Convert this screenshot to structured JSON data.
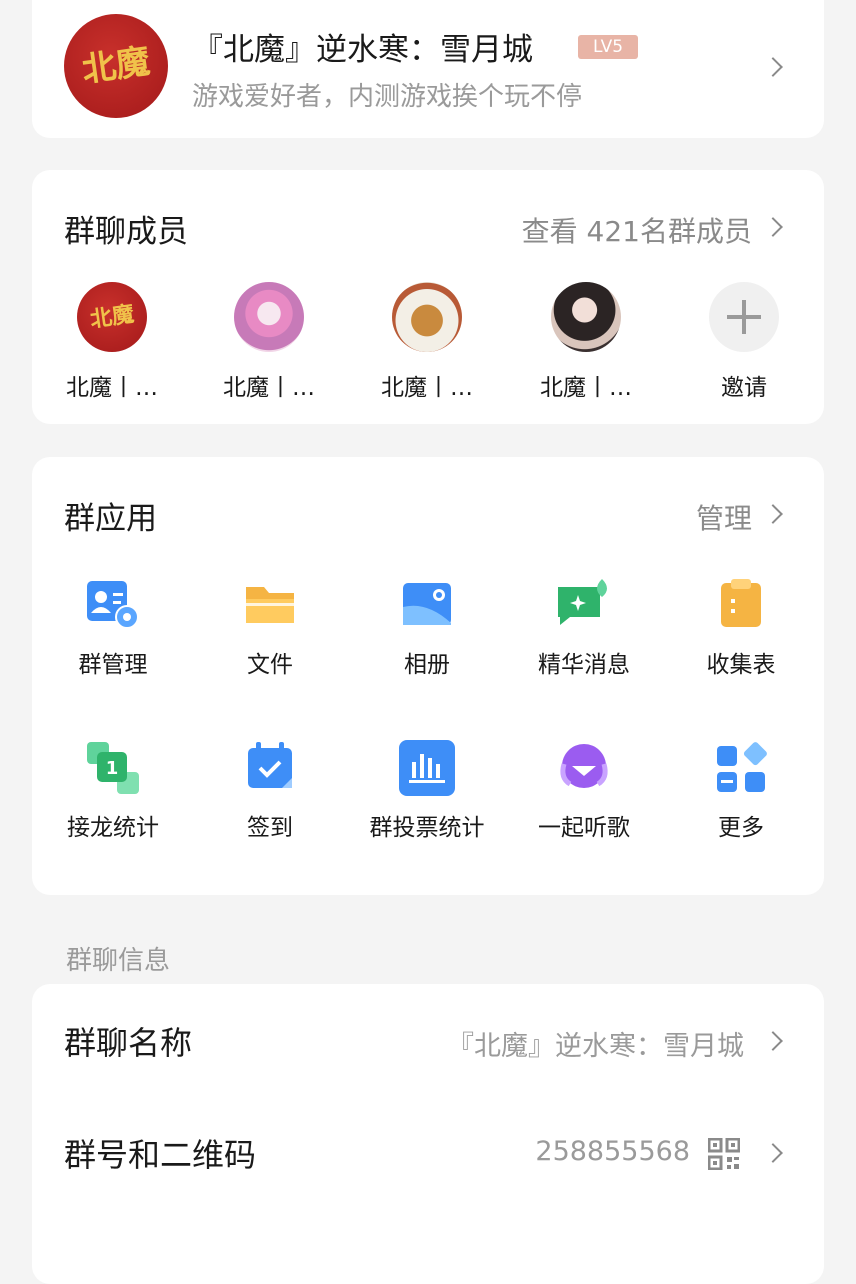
{
  "header": {
    "avatar_text": "北魔",
    "title": "『北魔』逆水寒：雪月城",
    "level": "LV5",
    "subtitle": "游戏爱好者，内测游戏挨个玩不停"
  },
  "members": {
    "title": "群聊成员",
    "view_all": "查看 421名群成员",
    "list": [
      {
        "name": "北魔丨…",
        "avatar_text": "北魔"
      },
      {
        "name": "北魔丨…"
      },
      {
        "name": "北魔丨…"
      },
      {
        "name": "北魔丨…"
      }
    ],
    "invite_label": "邀请"
  },
  "apps": {
    "title": "群应用",
    "manage": "管理",
    "items": [
      {
        "label": "群管理",
        "icon": "group-manage-icon"
      },
      {
        "label": "文件",
        "icon": "folder-icon"
      },
      {
        "label": "相册",
        "icon": "photo-album-icon"
      },
      {
        "label": "精华消息",
        "icon": "essence-message-icon"
      },
      {
        "label": "收集表",
        "icon": "clipboard-icon"
      },
      {
        "label": "接龙统计",
        "icon": "relay-icon"
      },
      {
        "label": "签到",
        "icon": "checkin-calendar-icon"
      },
      {
        "label": "群投票统计",
        "icon": "vote-chart-icon"
      },
      {
        "label": "一起听歌",
        "icon": "listen-music-icon"
      },
      {
        "label": "更多",
        "icon": "more-apps-icon"
      }
    ]
  },
  "info": {
    "caption": "群聊信息",
    "rows": [
      {
        "key": "群聊名称",
        "value": "『北魔』逆水寒：雪月城"
      },
      {
        "key": "群号和二维码",
        "value": "258855568"
      }
    ]
  },
  "colors": {
    "background": "#f4f4f4",
    "card": "#ffffff",
    "level_badge": "#e8b4a6",
    "secondary_text": "#9a9a9a"
  }
}
